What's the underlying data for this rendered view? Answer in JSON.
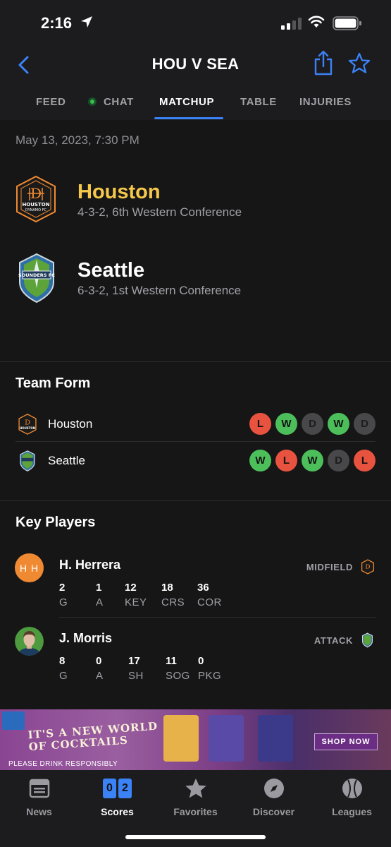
{
  "status": {
    "time": "2:16"
  },
  "header": {
    "title": "HOU V SEA"
  },
  "tabs": [
    {
      "label": "FEED"
    },
    {
      "label": "CHAT"
    },
    {
      "label": "MATCHUP"
    },
    {
      "label": "TABLE"
    },
    {
      "label": "INJURIES"
    }
  ],
  "active_tab": "MATCHUP",
  "match": {
    "date": "May 13, 2023, 7:30 PM"
  },
  "teams": [
    {
      "name": "Houston",
      "record": "4-3-2, 6th Western Conference",
      "name_color": "#f5c84b"
    },
    {
      "name": "Seattle",
      "record": "6-3-2, 1st Western Conference",
      "name_color": "#ffffff"
    }
  ],
  "team_form": {
    "title": "Team Form",
    "rows": [
      {
        "team": "Houston",
        "results": [
          "L",
          "W",
          "D",
          "W",
          "D"
        ]
      },
      {
        "team": "Seattle",
        "results": [
          "W",
          "L",
          "W",
          "D",
          "L"
        ]
      }
    ]
  },
  "key_players": {
    "title": "Key Players",
    "players": [
      {
        "initials": "H H",
        "name": "H. Herrera",
        "position": "MIDFIELD",
        "stats": [
          {
            "v": "2",
            "l": "G"
          },
          {
            "v": "1",
            "l": "A"
          },
          {
            "v": "12",
            "l": "KEY"
          },
          {
            "v": "18",
            "l": "CRS"
          },
          {
            "v": "36",
            "l": "COR"
          }
        ]
      },
      {
        "name": "J. Morris",
        "position": "ATTACK",
        "stats": [
          {
            "v": "8",
            "l": "G"
          },
          {
            "v": "0",
            "l": "A"
          },
          {
            "v": "17",
            "l": "SH"
          },
          {
            "v": "11",
            "l": "SOG"
          },
          {
            "v": "0",
            "l": "PKG"
          }
        ]
      }
    ]
  },
  "ad": {
    "headline_1": "IT'S A NEW WORLD",
    "headline_2": "OF COCKTAILS",
    "footer": "PLEASE DRINK RESPONSIBLY",
    "cta": "SHOP NOW"
  },
  "bottom_nav": [
    {
      "label": "News",
      "icon": "news-icon"
    },
    {
      "label": "Scores",
      "icon": "scores-icon",
      "score_a": "0",
      "score_b": "2"
    },
    {
      "label": "Favorites",
      "icon": "star-icon"
    },
    {
      "label": "Discover",
      "icon": "compass-icon"
    },
    {
      "label": "Leagues",
      "icon": "ball-icon"
    }
  ],
  "active_nav": "Scores",
  "colors": {
    "accent": "#3b82f6",
    "win": "#4cbf5b",
    "loss": "#e8533f",
    "draw": "#48484a",
    "houston": "#f08a32"
  }
}
